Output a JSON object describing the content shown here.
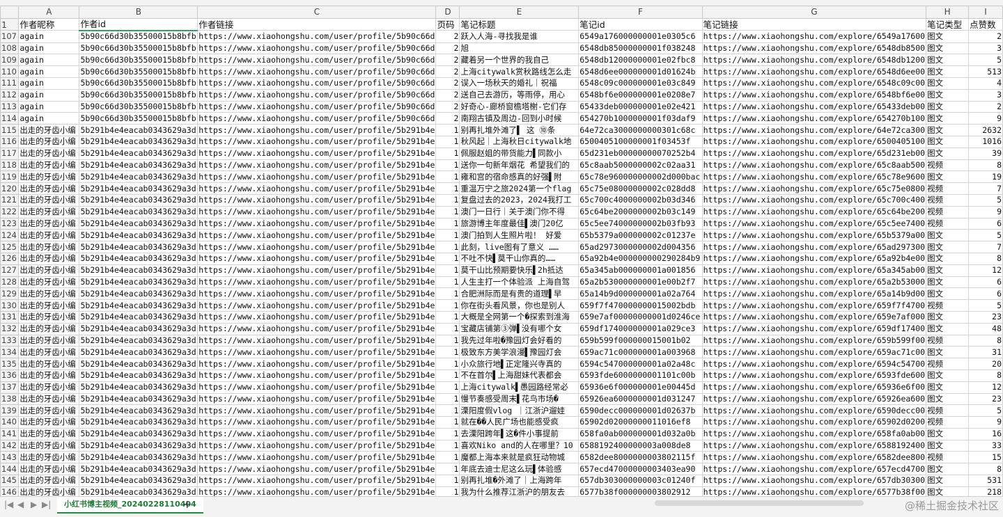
{
  "columns": [
    "A",
    "B",
    "C",
    "D",
    "E",
    "F",
    "G",
    "H",
    "I"
  ],
  "header_row": {
    "num": "1",
    "cells": [
      "作者昵称",
      "作者id",
      "作者链接",
      "页码",
      "笔记标题",
      "笔记id",
      "笔记链接",
      "笔记类型",
      "点赞数"
    ]
  },
  "rows": [
    [
      "107",
      "again",
      "5b90c66d30b35500015b8bfb",
      "https://www.xiaohongshu.com/user/profile/5b90c66d",
      "2",
      "跃入人海-寻找我是谁",
      "6549a176000000001e0305c6",
      "https://www.xiaohongshu.com/explore/6549a17600",
      "图文",
      "2"
    ],
    [
      "108",
      "again",
      "5b90c66d30b35500015b8bfb",
      "https://www.xiaohongshu.com/user/profile/5b90c66d",
      "2",
      "旭",
      "6548db85000000001f038248",
      "https://www.xiaohongshu.com/explore/6548db8500",
      "图文",
      "3"
    ],
    [
      "109",
      "again",
      "5b90c66d30b35500015b8bfb",
      "https://www.xiaohongshu.com/user/profile/5b90c66d",
      "2",
      "藏着另一个世界的我自己",
      "6548db12000000001e02fbc8",
      "https://www.xiaohongshu.com/explore/6548db1200",
      "图文",
      "5"
    ],
    [
      "110",
      "again",
      "5b90c66d30b35500015b8bfb",
      "https://www.xiaohongshu.com/user/profile/5b90c66d",
      "2",
      "上海citywalk赏秋路线怎么走",
      "6548d6ee000000001d01624b",
      "https://www.xiaohongshu.com/explore/6548d6ee00",
      "图文",
      "513"
    ],
    [
      "111",
      "again",
      "5b90c66d30b35500015b8bfb",
      "https://www.xiaohongshu.com/user/profile/5b90c66d",
      "2",
      "误入一场秋天的婚礼｜祝福",
      "6548c09c000000001e03c849",
      "https://www.xiaohongshu.com/explore/6548c09c00",
      "图文",
      "4"
    ],
    [
      "112",
      "again",
      "5b90c66d30b35500015b8bfb",
      "https://www.xiaohongshu.com/user/profile/5b90c66d",
      "2",
      "送自己去游历，等雨停，用心",
      "6548bf6e000000001e0208e7",
      "https://www.xiaohongshu.com/explore/6548bf6e00",
      "图文",
      "3"
    ],
    [
      "113",
      "again",
      "5b90c66d30b35500015b8bfb",
      "https://www.xiaohongshu.com/user/profile/5b90c66d",
      "2",
      "好奇心-廊桥窗檐塔榭-它们存",
      "65433deb000000001e02e421",
      "https://www.xiaohongshu.com/explore/65433deb00",
      "图文",
      "2"
    ],
    [
      "114",
      "again",
      "5b90c66d30b35500015b8bfb",
      "https://www.xiaohongshu.com/user/profile/5b90c66d",
      "2",
      "南翔古镇及周边-回到小时候",
      "654270b1000000001f03daf9",
      "https://www.xiaohongshu.com/explore/654270b100",
      "图文",
      "9"
    ],
    [
      "115",
      "出走的牙齿小编",
      "5b291b4e4eacab0343629a3d",
      "https://www.xiaohongshu.com/user/profile/5b291b4e",
      "1",
      "别再扎堆外滩了▌  这 ⑩条",
      "64e72ca3000000000301c68c",
      "https://www.xiaohongshu.com/explore/64e72ca300",
      "图文",
      "2632"
    ],
    [
      "116",
      "出走的牙齿小编",
      "5b291b4e4eacab0343629a3d",
      "https://www.xiaohongshu.com/user/profile/5b291b4e",
      "1",
      "秋风起｜上海秋日citywalk地",
      "6500405100000001f03453f",
      "https://www.xiaohongshu.com/explore/6500405100",
      "图文",
      "1016"
    ],
    [
      "117",
      "出走的牙齿小编",
      "5b291b4e4eacab0343629a3d",
      "https://www.xiaohongshu.com/user/profile/5b291b4e",
      "1",
      "佩服赵姐的带货能力▌同款小",
      "65d231eb00000000070252b4",
      "https://www.xiaohongshu.com/explore/65d231eb00",
      "图文",
      "39"
    ],
    [
      "118",
      "出走的牙齿小编",
      "5b291b4e4eacab0343629a3d",
      "https://www.xiaohongshu.com/user/profile/5b291b4e",
      "1",
      "送你一句新年烟花 希望我们的",
      "65c8aab5000000002c02aa31",
      "https://www.xiaohongshu.com/explore/65c8aab500",
      "视频",
      "8"
    ],
    [
      "119",
      "出走的牙齿小编",
      "5b291b4e4eacab0343629a3d",
      "https://www.xiaohongshu.com/user/profile/5b291b4e",
      "1",
      "雍和宫的宿命感真的好强▌附",
      "65c78e960000000002d000bac",
      "https://www.xiaohongshu.com/explore/65c78e9600",
      "图文",
      "19"
    ],
    [
      "120",
      "出走的牙齿小编",
      "5b291b4e4eacab0343629a3d",
      "https://www.xiaohongshu.com/user/profile/5b291b4e",
      "1",
      "重温万宁之旅2024第一个flag",
      "65c75e08000000002c028dd8",
      "https://www.xiaohongshu.com/explore/65c75e0800",
      "视频",
      "7"
    ],
    [
      "121",
      "出走的牙齿小编",
      "5b291b4e4eacab0343629a3d",
      "https://www.xiaohongshu.com/user/profile/5b291b4e",
      "1",
      "复盘过去的2023，2024我打工",
      "65c700c4000000002b03d346",
      "https://www.xiaohongshu.com/explore/65c700c400",
      "视频",
      "5"
    ],
    [
      "122",
      "出走的牙齿小编",
      "5b291b4e4eacab0343629a3d",
      "https://www.xiaohongshu.com/user/profile/5b291b4e",
      "1",
      "澳门一日行｜关于澳门你不得",
      "65c64be2000000002b03c149",
      "https://www.xiaohongshu.com/explore/65c64be200",
      "视频",
      "9"
    ],
    [
      "123",
      "出走的牙齿小编",
      "5b291b4e4eacab0343629a3d",
      "https://www.xiaohongshu.com/user/profile/5b291b4e",
      "1",
      "旅游博主年度最佳▌澳门20亿",
      "65c5ee74000000002b03fb93",
      "https://www.xiaohongshu.com/explore/65c5ee7400",
      "视频",
      "6"
    ],
    [
      "124",
      "出走的牙齿小编",
      "5b291b4e4eacab0343629a3d",
      "https://www.xiaohongshu.com/user/profile/5b291b4e",
      "1",
      "澳门拍到人生照片啦！ 好爱",
      "65b5379a000000002c01237e",
      "https://www.xiaohongshu.com/explore/65b5379a00",
      "图文",
      "5"
    ],
    [
      "125",
      "出走的牙齿小编",
      "5b291b4e4eacab0343629a3d",
      "https://www.xiaohongshu.com/user/profile/5b291b4e",
      "1",
      "此刻，live图有了意义 ……",
      "65ad2973000000002d004356",
      "https://www.xiaohongshu.com/explore/65ad297300",
      "图文",
      "7"
    ],
    [
      "126",
      "出走的牙齿小编",
      "5b291b4e4eacab0343629a3d",
      "https://www.xiaohongshu.com/user/profile/5b291b4e",
      "1",
      "不吐不快▌莫干山你真的……",
      "65a92b4e000000000290284b9",
      "https://www.xiaohongshu.com/explore/65a92b4e00",
      "图文",
      "8"
    ],
    [
      "127",
      "出走的牙齿小编",
      "5b291b4e4eacab0343629a3d",
      "https://www.xiaohongshu.com/user/profile/5b291b4e",
      "1",
      "莫干山比预期要快乐▌2h抵达",
      "65a345ab000000001a001856",
      "https://www.xiaohongshu.com/explore/65a345ab00",
      "图文",
      "12"
    ],
    [
      "128",
      "出走的牙齿小编",
      "5b291b4e4eacab0343629a3d",
      "https://www.xiaohongshu.com/user/profile/5b291b4e",
      "1",
      "人生主打一个体验派 上海自驾",
      "65a2b530000000001e00b2f7",
      "https://www.xiaohongshu.com/explore/65a2b53000",
      "图文",
      "6"
    ],
    [
      "129",
      "出走的牙齿小编",
      "5b291b4e4eacab0343629a3d",
      "https://www.xiaohongshu.com/user/profile/5b291b4e",
      "1",
      "合肥洲际而是有贵的道理▌早",
      "65a14b9d000000001a02a764",
      "https://www.xiaohongshu.com/explore/65a14b9d00",
      "图文",
      "6"
    ],
    [
      "130",
      "出走的牙齿小编",
      "5b291b4e4eacab0343629a3d",
      "https://www.xiaohongshu.com/user/profile/5b291b4e",
      "1",
      "你在街头看风景，你也是别人",
      "659f7f470000000015002bdb",
      "https://www.xiaohongshu.com/explore/659f7f4700",
      "视频",
      "5"
    ],
    [
      "131",
      "出走的牙齿小编",
      "5b291b4e4eacab0343629a3d",
      "https://www.xiaohongshu.com/user/profile/5b291b4e",
      "1",
      "大概是全网第一个�探索到淮海",
      "659e7af00000000001d0246ce",
      "https://www.xiaohongshu.com/explore/659e7af000",
      "图文",
      "23"
    ],
    [
      "132",
      "出走的牙齿小编",
      "5b291b4e4eacab0343629a3d",
      "https://www.xiaohongshu.com/user/profile/5b291b4e",
      "1",
      "宝藏店铺第③弹▌没有哪个女",
      "659df174000000001a029ce3",
      "https://www.xiaohongshu.com/explore/659df17400",
      "图文",
      "48"
    ],
    [
      "133",
      "出走的牙齿小编",
      "5b291b4e4eacab0343629a3d",
      "https://www.xiaohongshu.com/user/profile/5b291b4e",
      "1",
      "我先过年啦�豫园灯会好看的",
      "659b599f000000015001b02",
      "https://www.xiaohongshu.com/explore/659b599f00",
      "视频",
      "8"
    ],
    [
      "134",
      "出走的牙齿小编",
      "5b291b4e4eacab0343629a3d",
      "https://www.xiaohongshu.com/user/profile/5b291b4e",
      "1",
      "极致东方美学浪漫▌豫园灯会",
      "659ac71c000000001a003968",
      "https://www.xiaohongshu.com/explore/659ac71c00",
      "图文",
      "31"
    ],
    [
      "135",
      "出走的牙齿小编",
      "5b291b4e4eacab0343629a3d",
      "https://www.xiaohongshu.com/user/profile/5b291b4e",
      "1",
      "小众旅行地▌正定隆兴寺真的",
      "6594c547000000001a02a48c",
      "https://www.xiaohongshu.com/explore/6594c54700",
      "视频",
      "20"
    ],
    [
      "136",
      "出走的牙齿小编",
      "5b291b4e4eacab0343629a3d",
      "https://www.xiaohongshu.com/user/profile/5b291b4e",
      "1",
      "不在首尔▌上海甜妹代表都会",
      "6593fde6000000001101c00b",
      "https://www.xiaohongshu.com/explore/6593fde600",
      "图文",
      "8"
    ],
    [
      "137",
      "出走的牙齿小编",
      "5b291b4e4eacab0343629a3d",
      "https://www.xiaohongshu.com/user/profile/5b291b4e",
      "1",
      "上海citywalk▌愚园路经常必",
      "65936e6f000000001e00445d",
      "https://www.xiaohongshu.com/explore/65936e6f00",
      "图文",
      "12"
    ],
    [
      "138",
      "出走的牙齿小编",
      "5b291b4e4eacab0343629a3d",
      "https://www.xiaohongshu.com/user/profile/5b291b4e",
      "1",
      "慢节奏感受周末▌花鸟市场�",
      "65926ea6000000001d031247",
      "https://www.xiaohongshu.com/explore/65926ea600",
      "图文",
      "23"
    ],
    [
      "139",
      "出走的牙齿小编",
      "5b291b4e4eacab0343629a3d",
      "https://www.xiaohongshu.com/user/profile/5b291b4e",
      "1",
      "溧阳度假vlog ｜江浙沪遛娃",
      "6590decc000000001d02637b",
      "https://www.xiaohongshu.com/explore/6590decc00",
      "视频",
      "5"
    ],
    [
      "140",
      "出走的牙齿小编",
      "5b291b4e4eacab0343629a3d",
      "https://www.xiaohongshu.com/user/profile/5b291b4e",
      "1",
      "就在��人民广场也能感受疯",
      "65902d02000000011016ef8",
      "https://www.xiaohongshu.com/explore/65902d0200",
      "视频",
      "9"
    ],
    [
      "141",
      "出走的牙齿小编",
      "5b291b4e4eacab0343629a3d",
      "https://www.xiaohongshu.com/user/profile/5b291b4e",
      "1",
      "去溧阳跨年▌这�件小事提前",
      "658fa0ab000000001d032a0b",
      "https://www.xiaohongshu.com/explore/658fa0ab00",
      "图文",
      "16"
    ],
    [
      "142",
      "出走的牙齿小编",
      "5b291b4e4eacab0343629a3d",
      "https://www.xiaohongshu.com/user/profile/5b291b4e",
      "1",
      "喜欢Niko and的人在哪里？10",
      "6588192400000003a008de8",
      "https://www.xiaohongshu.com/explore/6588192400",
      "图文",
      "33"
    ],
    [
      "143",
      "出走的牙齿小编",
      "5b291b4e4eacab0343629a3d",
      "https://www.xiaohongshu.com/user/profile/5b291b4e",
      "1",
      "魔都上海本来就是疯狂动物城",
      "6582dee8000000003802115f",
      "https://www.xiaohongshu.com/explore/6582dee800",
      "视频",
      "15"
    ],
    [
      "144",
      "出走的牙齿小编",
      "5b291b4e4eacab0343629a3d",
      "https://www.xiaohongshu.com/user/profile/5b291b4e",
      "1",
      "年底去迪士尼这么玩▌体验感",
      "657ecd47000000003403ea90",
      "https://www.xiaohongshu.com/explore/657ecd4700",
      "图文",
      "8"
    ],
    [
      "145",
      "出走的牙齿小编",
      "5b291b4e4eacab0343629a3d",
      "https://www.xiaohongshu.com/user/profile/5b291b4e",
      "1",
      "别再扎堆�外滩了｜上海跨年",
      "657db303000000003c01240f",
      "https://www.xiaohongshu.com/explore/657db30300",
      "图文",
      "531"
    ],
    [
      "146",
      "出走的牙齿小编",
      "5b291b4e4eacab0343629a3d",
      "https://www.xiaohongshu.com/user/profile/5b291b4e",
      "1",
      "我为什么推荐江浙沪的朋友去",
      "6577b38f000000003802912",
      "https://www.xiaohongshu.com/explore/6577b38f00",
      "图文",
      "218"
    ]
  ],
  "tabbar": {
    "sheet_name": "小红书博主视频_20240228110404",
    "add": "+",
    "nav": [
      "|◀",
      "◀",
      "▶",
      "▶|"
    ]
  },
  "watermark": "@稀土掘金技术社区"
}
